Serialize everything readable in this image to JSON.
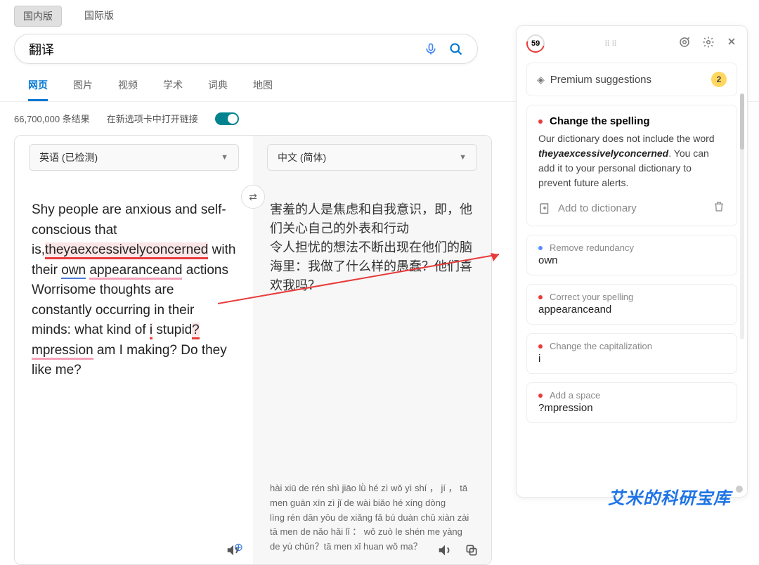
{
  "top_tabs": {
    "domestic": "国内版",
    "intl": "国际版"
  },
  "search": {
    "query": "翻译"
  },
  "nav": {
    "web": "网页",
    "image": "图片",
    "video": "视频",
    "academic": "学术",
    "dict": "词典",
    "map": "地图"
  },
  "results": {
    "count": "66,700,000 条结果",
    "open_new": "在新选项卡中打开链接"
  },
  "lang": {
    "src": "英语 (已检测)",
    "tgt": "中文 (简体)"
  },
  "source_text": {
    "p1a": "Shy people are anxious and self-conscious that is,",
    "err1": "theyaexcessivelyconcerned",
    "p1b": " with their ",
    "err_own": "own",
    "p1c": " ",
    "err_appear": "appearanceand",
    "p1d": " actions Worrisome thoughts are constantly occurring in their minds: what kind of ",
    "err_i": "i",
    "p1e": " stupid",
    "err_q": "?",
    "err_mp": "mpression",
    "p1f": " am I making? Do they like me?"
  },
  "target_text": {
    "p1": "害羞的人是焦虑和自我意识，即，他们关心自己的外表和行动",
    "p2": "令人担忧的想法不断出现在他们的脑海里：我做了什么样的愚蠢？他们喜欢我吗？"
  },
  "pinyin": "hài xiū de rén shì jiāo lǜ hé zì wǒ yì shí ， jí ， tā men guān xīn zì jǐ de wài biǎo hé xíng dòng\nlìng rén dān yōu de xiǎng fǎ bú duàn chū xiàn zài tā men de nǎo hǎi lǐ ： wǒ zuò le shén me yàng de yú chǔn？tā men xǐ huan wǒ ma？",
  "grammar": {
    "score": "59",
    "premium": {
      "label": "Premium suggestions",
      "badge": "2"
    },
    "card1": {
      "title": "Change the spelling",
      "body_a": "Our dictionary does not include the word ",
      "word": "theyaexcessivelyconcerned",
      "body_b": ". You can add it to your personal dictionary to prevent future alerts.",
      "add": "Add to dictionary"
    },
    "card2": {
      "title": "Remove redundancy",
      "word": "own"
    },
    "card3": {
      "title": "Correct your spelling",
      "word": "appearanceand"
    },
    "card4": {
      "title": "Change the capitalization",
      "word": "i"
    },
    "card5": {
      "title": "Add a space",
      "word": "?mpression"
    }
  },
  "watermark": "艾米的科研宝库"
}
